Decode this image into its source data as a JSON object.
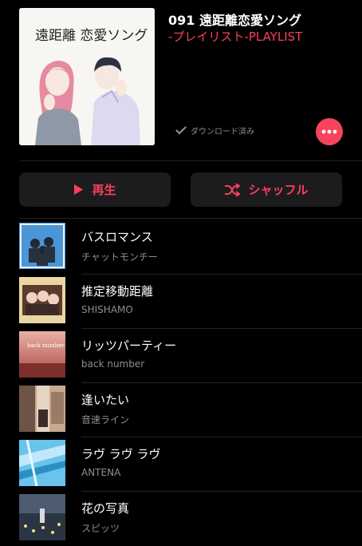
{
  "playlist": {
    "title": "091 遠距離恋愛ソング",
    "subtitle": "-プレイリスト-PLAYLIST",
    "cover_text": "遠距離 恋愛ソング",
    "download_status": "ダウンロード済み",
    "accent_color": "#fa3f5c"
  },
  "actions": {
    "play_label": "再生",
    "shuffle_label": "シャッフル"
  },
  "tracks": [
    {
      "title": "バスロマンス",
      "artist": "チャットモンチー"
    },
    {
      "title": "推定移動距離",
      "artist": "SHISHAMO"
    },
    {
      "title": "リッツパーティー",
      "artist": "back number"
    },
    {
      "title": "逢いたい",
      "artist": "音速ライン"
    },
    {
      "title": "ラヴ ラヴ ラヴ",
      "artist": "ANTENA"
    },
    {
      "title": "花の写真",
      "artist": "スピッツ"
    }
  ],
  "track_art_text": {
    "track_3": "back number"
  },
  "icons": {
    "more": "ellipsis-icon",
    "play": "play-icon",
    "shuffle": "shuffle-icon",
    "downloaded": "checkmark-icon"
  }
}
